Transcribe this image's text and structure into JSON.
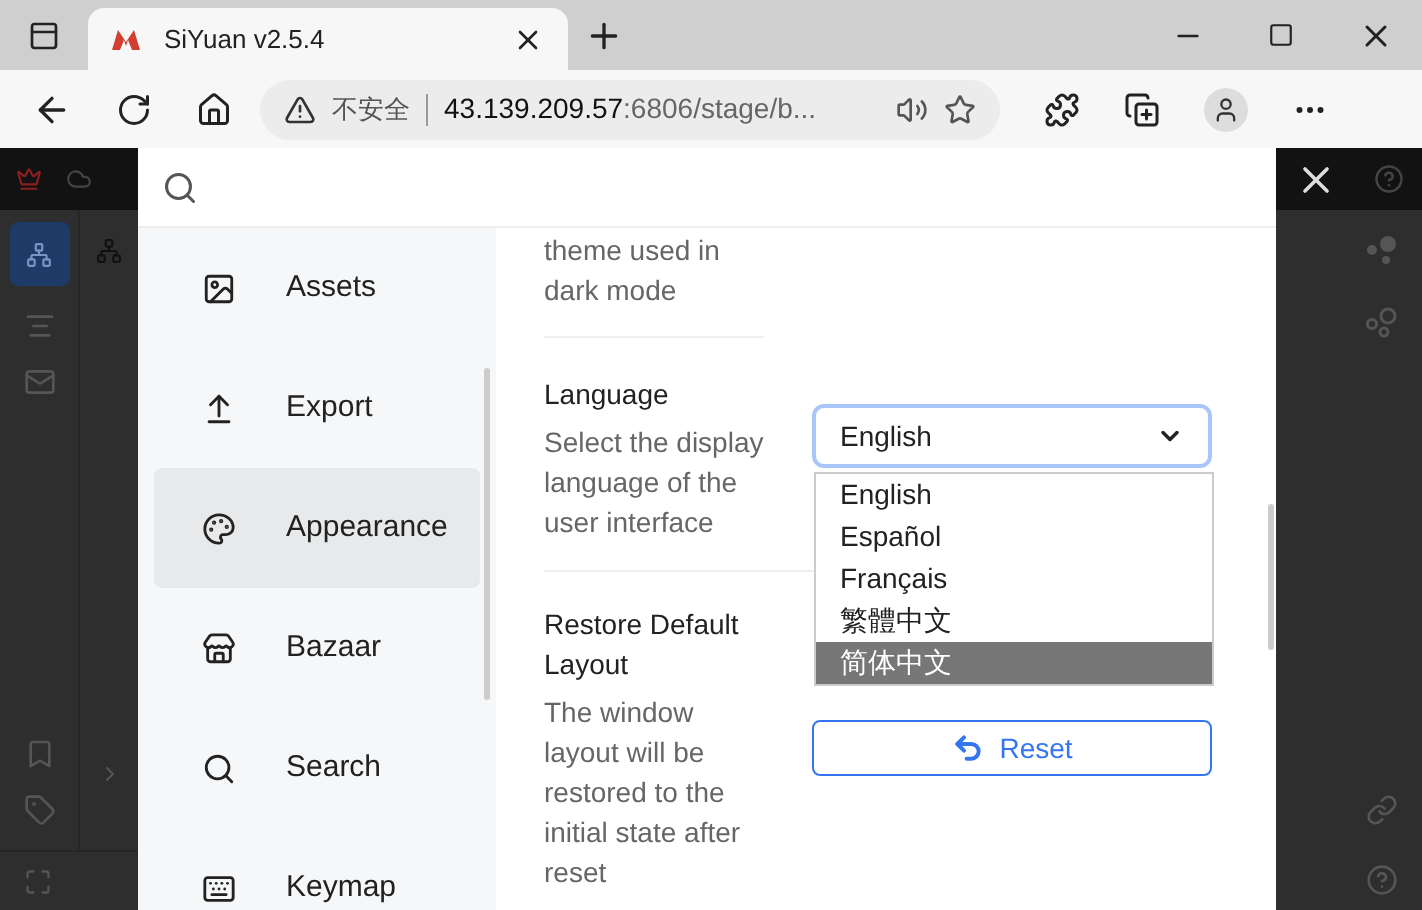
{
  "browser": {
    "tab_title": "SiYuan v2.5.4",
    "security": "不安全",
    "url_host": "43.139.209.57",
    "url_path": ":6806/stage/b..."
  },
  "settings": {
    "sidebar": {
      "items": [
        {
          "label": "Assets",
          "kind": "image",
          "selected": false
        },
        {
          "label": "Export",
          "kind": "upload",
          "selected": false
        },
        {
          "label": "Appearance",
          "kind": "palette",
          "selected": true
        },
        {
          "label": "Bazaar",
          "kind": "store",
          "selected": false
        },
        {
          "label": "Search",
          "kind": "search",
          "selected": false
        },
        {
          "label": "Keymap",
          "kind": "keyboard",
          "selected": false
        }
      ]
    },
    "partial_description": "theme used in dark mode",
    "language": {
      "title": "Language",
      "description": "Select the display language of the user interface",
      "value": "English",
      "expanded": true,
      "options": [
        {
          "label": "English",
          "highlighted": false
        },
        {
          "label": "Español",
          "highlighted": false
        },
        {
          "label": "Français",
          "highlighted": false
        },
        {
          "label": "繁體中文",
          "highlighted": false
        },
        {
          "label": "简体中文",
          "highlighted": true
        }
      ]
    },
    "restore": {
      "title": "Restore Default Layout",
      "description": "The window layout will be restored to the initial state after reset",
      "button": "Reset"
    }
  }
}
